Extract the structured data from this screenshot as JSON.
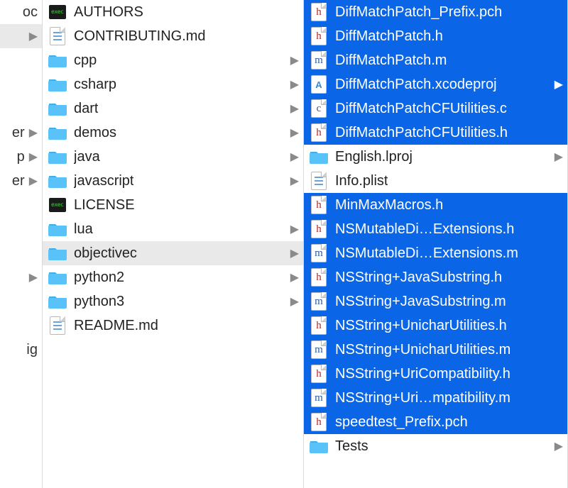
{
  "col0": [
    {
      "label": "oc",
      "expandable": false,
      "selected": false
    },
    {
      "label": "",
      "expandable": true,
      "selected": true
    },
    {
      "label": "",
      "expandable": false
    },
    {
      "label": "",
      "expandable": false
    },
    {
      "label": "",
      "expandable": false
    },
    {
      "label": "er",
      "expandable": true
    },
    {
      "label": "p",
      "expandable": true
    },
    {
      "label": "er",
      "expandable": true
    },
    {
      "label": "",
      "expandable": false
    },
    {
      "label": "",
      "expandable": false
    },
    {
      "label": "",
      "expandable": false
    },
    {
      "label": "",
      "expandable": true
    },
    {
      "label": "",
      "expandable": false
    },
    {
      "label": "",
      "expandable": false
    },
    {
      "label": "ig",
      "expandable": false
    }
  ],
  "col1": [
    {
      "name": "AUTHORS",
      "type": "exec",
      "expandable": false,
      "selected": false
    },
    {
      "name": "CONTRIBUTING.md",
      "type": "docmd",
      "expandable": false,
      "selected": false
    },
    {
      "name": "cpp",
      "type": "folder",
      "expandable": true,
      "selected": false
    },
    {
      "name": "csharp",
      "type": "folder",
      "expandable": true,
      "selected": false
    },
    {
      "name": "dart",
      "type": "folder",
      "expandable": true,
      "selected": false
    },
    {
      "name": "demos",
      "type": "folder",
      "expandable": true,
      "selected": false
    },
    {
      "name": "java",
      "type": "folder",
      "expandable": true,
      "selected": false
    },
    {
      "name": "javascript",
      "type": "folder",
      "expandable": true,
      "selected": false
    },
    {
      "name": "LICENSE",
      "type": "exec",
      "expandable": false,
      "selected": false
    },
    {
      "name": "lua",
      "type": "folder",
      "expandable": true,
      "selected": false
    },
    {
      "name": "objectivec",
      "type": "folder",
      "expandable": true,
      "selected": true
    },
    {
      "name": "python2",
      "type": "folder",
      "expandable": true,
      "selected": false
    },
    {
      "name": "python3",
      "type": "folder",
      "expandable": true,
      "selected": false
    },
    {
      "name": "README.md",
      "type": "docmd",
      "expandable": false,
      "selected": false
    }
  ],
  "col2": [
    {
      "name": "DiffMatchPatch_Prefix.pch",
      "type": "doc-h",
      "expandable": false,
      "selected": true
    },
    {
      "name": "DiffMatchPatch.h",
      "type": "doc-h",
      "expandable": false,
      "selected": true
    },
    {
      "name": "DiffMatchPatch.m",
      "type": "doc-m",
      "expandable": false,
      "selected": true
    },
    {
      "name": "DiffMatchPatch.xcodeproj",
      "type": "xcode",
      "expandable": true,
      "selected": true
    },
    {
      "name": "DiffMatchPatchCFUtilities.c",
      "type": "doc-c",
      "expandable": false,
      "selected": true
    },
    {
      "name": "DiffMatchPatchCFUtilities.h",
      "type": "doc-h",
      "expandable": false,
      "selected": true
    },
    {
      "name": "English.lproj",
      "type": "folder",
      "expandable": true,
      "selected": false
    },
    {
      "name": "Info.plist",
      "type": "plist",
      "expandable": false,
      "selected": false
    },
    {
      "name": "MinMaxMacros.h",
      "type": "doc-h",
      "expandable": false,
      "selected": true
    },
    {
      "name": "NSMutableDi…Extensions.h",
      "type": "doc-h",
      "expandable": false,
      "selected": true
    },
    {
      "name": "NSMutableDi…Extensions.m",
      "type": "doc-m",
      "expandable": false,
      "selected": true
    },
    {
      "name": "NSString+JavaSubstring.h",
      "type": "doc-h",
      "expandable": false,
      "selected": true
    },
    {
      "name": "NSString+JavaSubstring.m",
      "type": "doc-m",
      "expandable": false,
      "selected": true
    },
    {
      "name": "NSString+UnicharUtilities.h",
      "type": "doc-h",
      "expandable": false,
      "selected": true
    },
    {
      "name": "NSString+UnicharUtilities.m",
      "type": "doc-m",
      "expandable": false,
      "selected": true
    },
    {
      "name": "NSString+UriCompatibility.h",
      "type": "doc-h",
      "expandable": false,
      "selected": true
    },
    {
      "name": "NSString+Uri…mpatibility.m",
      "type": "doc-m",
      "expandable": false,
      "selected": true
    },
    {
      "name": "speedtest_Prefix.pch",
      "type": "doc-h",
      "expandable": false,
      "selected": true
    },
    {
      "name": "Tests",
      "type": "folder",
      "expandable": true,
      "selected": false
    }
  ]
}
